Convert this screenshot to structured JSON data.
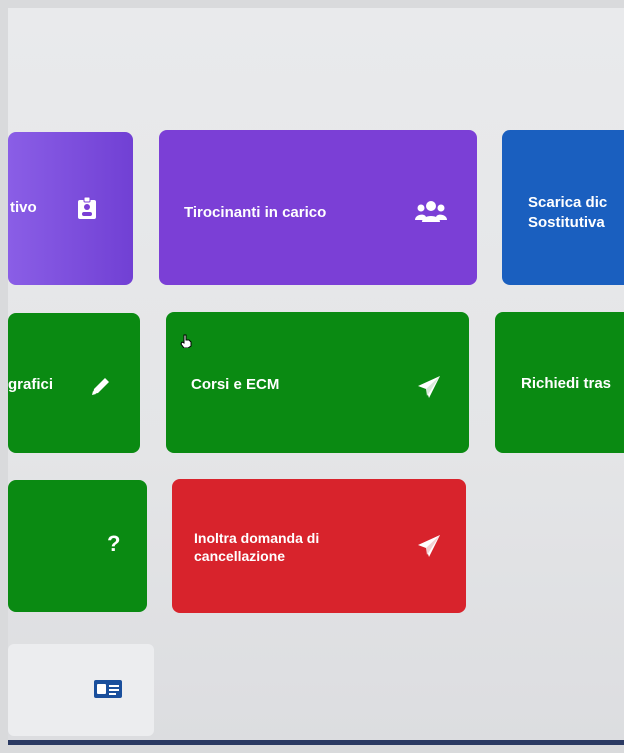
{
  "tiles": {
    "r1c1": {
      "label": "tivo",
      "icon": "id-badge-icon",
      "color": "#7b3fd6"
    },
    "r1c2": {
      "label": "Tirocinanti in carico",
      "icon": "users-icon",
      "color": "#7b3fd6"
    },
    "r1c3": {
      "label": "Scarica dic\nSostitutiva",
      "color": "#1a5fbf"
    },
    "r2c1": {
      "label": "grafici",
      "icon": "pencil-icon",
      "color": "#0a8a12"
    },
    "r2c2": {
      "label": "Corsi e ECM",
      "icon": "paper-plane-icon",
      "color": "#0a8a12"
    },
    "r2c3": {
      "label": "Richiedi tras",
      "color": "#0a8a12"
    },
    "r3c1": {
      "label": "?",
      "icon": "question-icon",
      "color": "#0a8a12"
    },
    "r3c2": {
      "label": "Inoltra domanda di\ncancellazione",
      "icon": "paper-plane-icon",
      "color": "#d8232c"
    }
  },
  "bottom_card": {
    "icon": "id-card-icon"
  }
}
